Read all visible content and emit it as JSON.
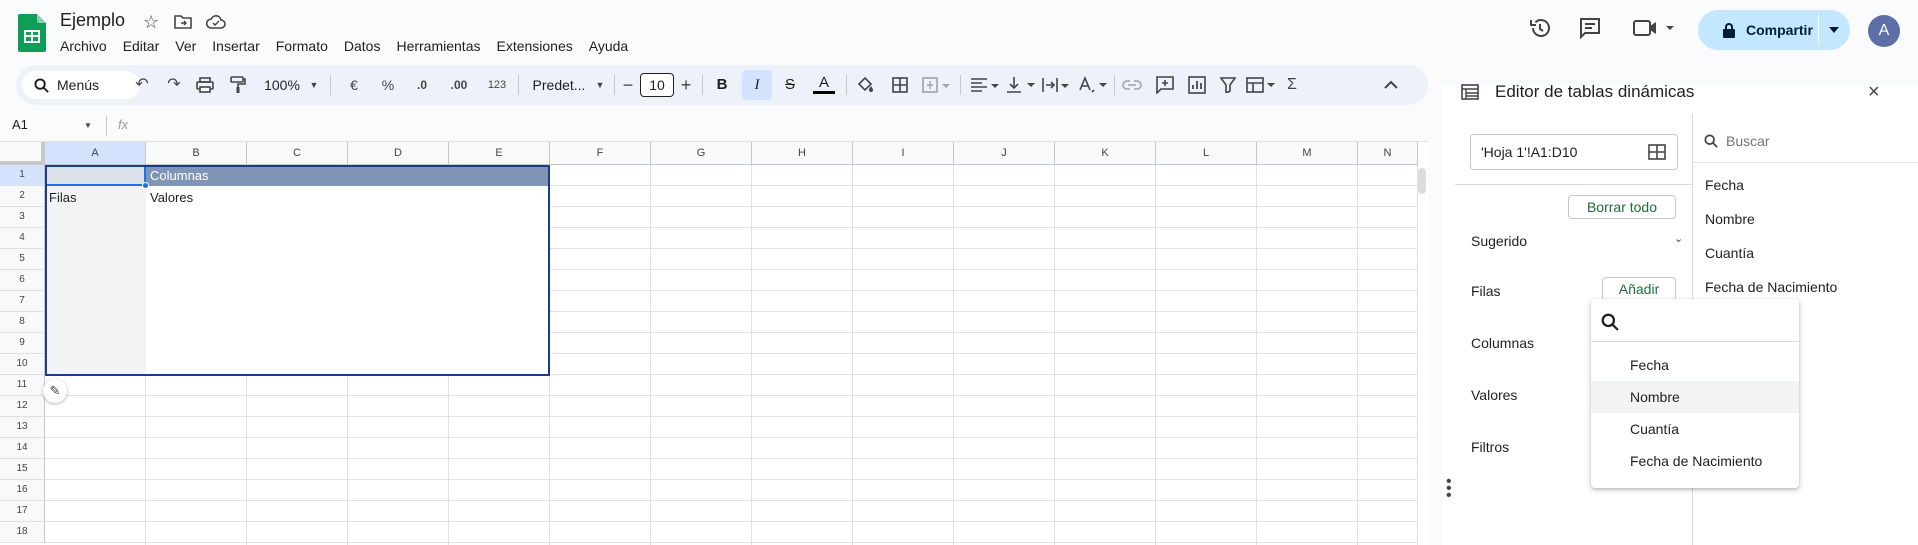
{
  "doc": {
    "title": "Ejemplo"
  },
  "menu": [
    "Archivo",
    "Editar",
    "Ver",
    "Insertar",
    "Formato",
    "Datos",
    "Herramientas",
    "Extensiones",
    "Ayuda"
  ],
  "header": {
    "share_label": "Compartir",
    "avatar_letter": "A"
  },
  "toolbar": {
    "menus_label": "Menús",
    "zoom": "100%",
    "currency": "€",
    "percent": "%",
    "dec_decrease": ".0",
    "dec_increase": ".00",
    "number_format": "123",
    "font": "Predet...",
    "font_size": "10",
    "bold": "B",
    "italic": "I",
    "strike": "S",
    "text_color": "A",
    "sum": "Σ"
  },
  "formula_bar": {
    "name_box": "A1",
    "fx": "fx",
    "value": ""
  },
  "grid": {
    "columns": [
      "A",
      "B",
      "C",
      "D",
      "E",
      "F",
      "G",
      "H",
      "I",
      "J",
      "K",
      "L",
      "M",
      "N"
    ],
    "rows": [
      "1",
      "2",
      "3",
      "4",
      "5",
      "6",
      "7",
      "8",
      "9",
      "10",
      "11",
      "12",
      "13",
      "14",
      "15",
      "16",
      "17",
      "18"
    ],
    "cells": {
      "B1": "Columnas",
      "A2": "Filas",
      "B2": "Valores"
    }
  },
  "panel": {
    "title": "Editor de tablas dinámicas",
    "range": "'Hoja 1'!A1:D10",
    "clear_all": "Borrar todo",
    "suggested": "Sugerido",
    "rows_label": "Filas",
    "add_label": "Añadir",
    "columns_label": "Columnas",
    "values_label": "Valores",
    "filters_label": "Filtros",
    "search_placeholder": "Buscar",
    "fields": [
      "Fecha",
      "Nombre",
      "Cuantía",
      "Fecha de Nacimiento"
    ]
  },
  "popup": {
    "search_value": "",
    "options": [
      "Fecha",
      "Nombre",
      "Cuantía",
      "Fecha de Nacimiento"
    ],
    "highlighted": "Nombre"
  },
  "colors": {
    "accent_green": "#1e6f3e",
    "share_bg": "#c2e7ff",
    "pivot_header": "#8095b6",
    "rows_area": "#f1f3f4",
    "selection": "#1a3b8a"
  }
}
